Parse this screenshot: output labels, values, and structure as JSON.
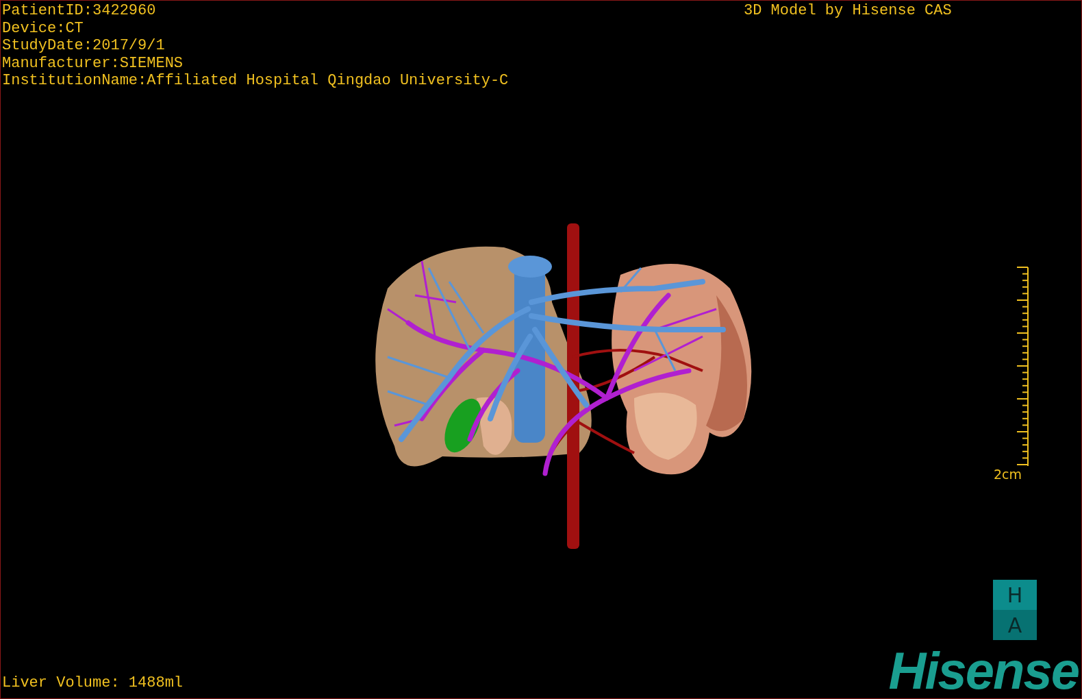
{
  "patient_info": [
    "PatientID:3422960",
    "Device:CT",
    "StudyDate:2017/9/1",
    "Manufacturer:SIEMENS",
    "InstitutionName:Affiliated Hospital Qingdao University-C"
  ],
  "model_credit": "3D Model by Hisense CAS",
  "scale_bar": {
    "label": "2cm"
  },
  "orientation_cube": {
    "top": "H",
    "bottom": "A"
  },
  "logo": "Hisense",
  "liver_volume": "Liver Volume: 1488ml"
}
